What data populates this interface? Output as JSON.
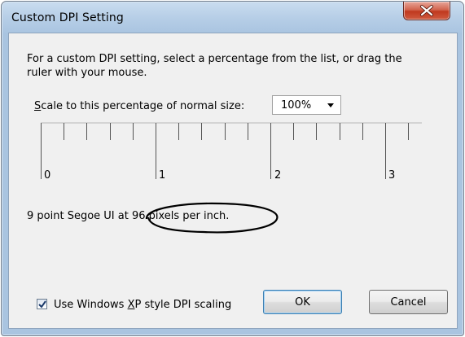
{
  "window": {
    "title": "Custom DPI Setting"
  },
  "dialog": {
    "instructions": "For a custom DPI setting, select a percentage from the list, or drag the ruler with your mouse.",
    "scale_label_mnemonic": "S",
    "scale_label_rest": "cale to this percentage of normal size:",
    "scale_value": "100%",
    "ruler_labels": [
      "0",
      "1",
      "2",
      "3"
    ],
    "info_text": "9 point Segoe UI at 96 pixels per inch.",
    "xp_checkbox": {
      "checked": true,
      "label_before": "Use Windows ",
      "label_mnemonic": "X",
      "label_after": "P style DPI scaling"
    },
    "ok_label": "OK",
    "cancel_label": "Cancel"
  },
  "icons": {
    "close": "close-icon",
    "dropdown": "chevron-down-icon",
    "check": "check-icon"
  }
}
